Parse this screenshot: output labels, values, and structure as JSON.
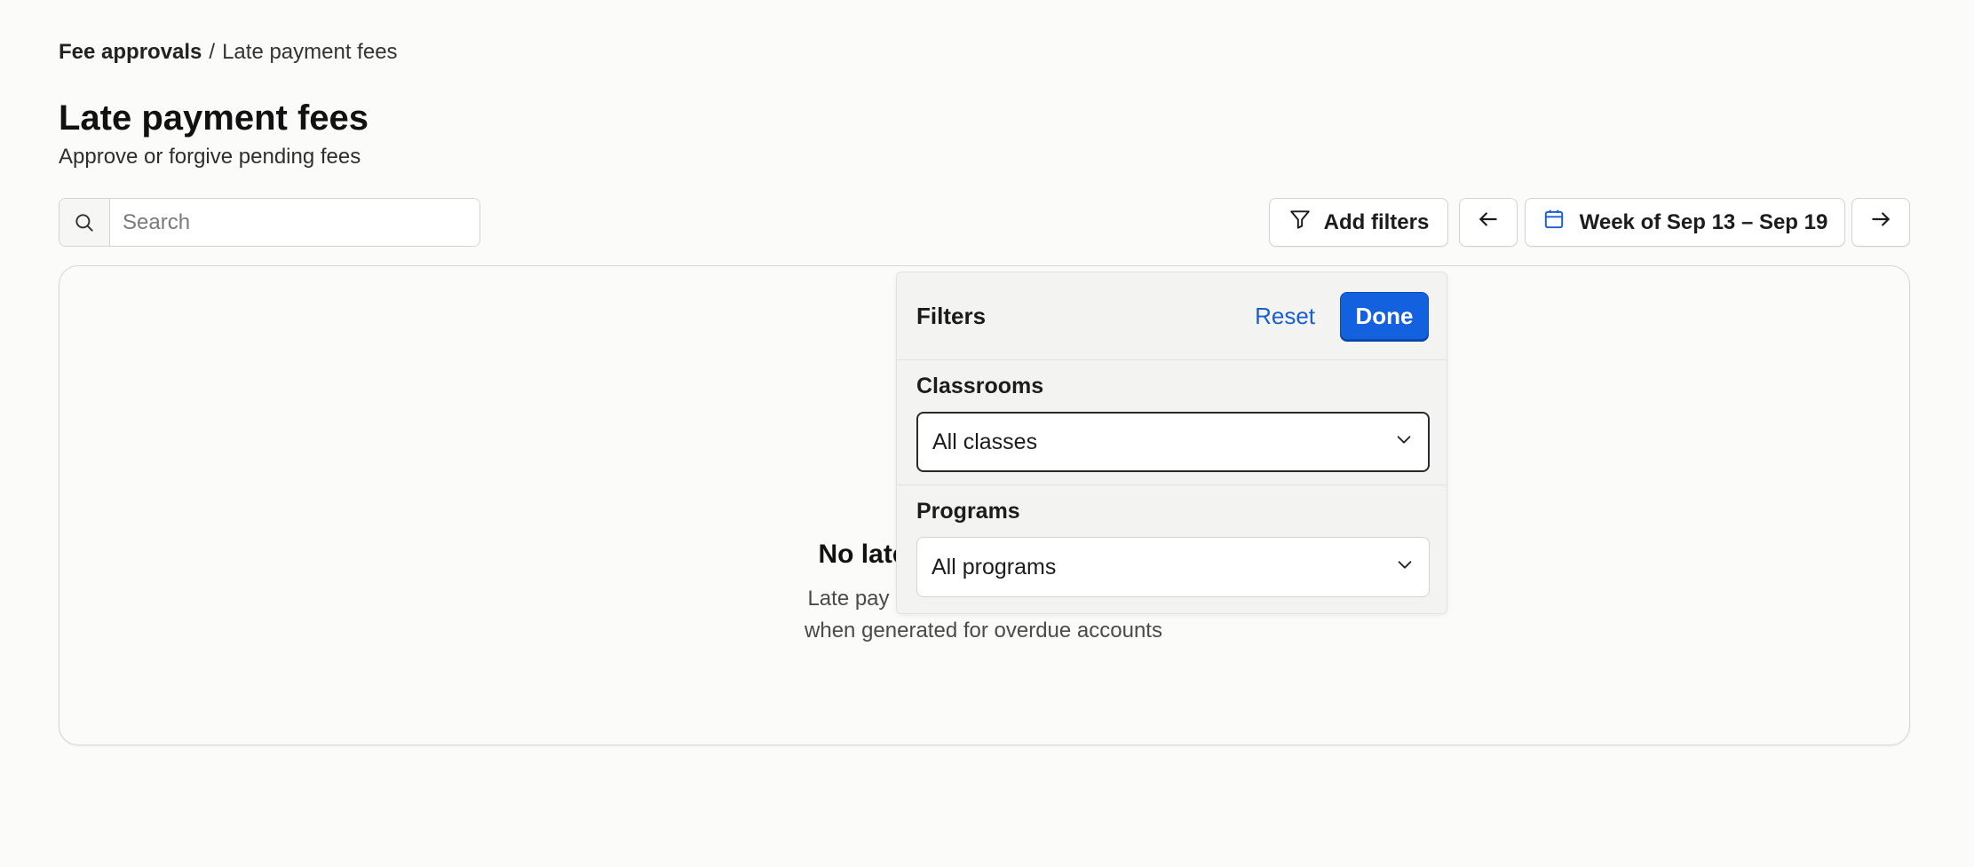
{
  "breadcrumb": {
    "parent": "Fee approvals",
    "separator": "/",
    "current": "Late payment fees"
  },
  "page": {
    "title": "Late payment fees",
    "subtitle": "Approve or forgive pending fees"
  },
  "search": {
    "placeholder": "Search",
    "icon": "search-icon"
  },
  "toolbar": {
    "add_filters_label": "Add filters",
    "add_filters_icon": "filter-icon",
    "prev_icon": "arrow-left-icon",
    "next_icon": "arrow-right-icon",
    "week_label": "Week of Sep 13 – Sep 19",
    "week_icon": "calendar-icon"
  },
  "empty_state": {
    "title": "No late",
    "line1": "Late pay",
    "line2": "when generated for overdue accounts"
  },
  "filters_panel": {
    "title": "Filters",
    "reset_label": "Reset",
    "done_label": "Done",
    "sections": [
      {
        "label": "Classrooms",
        "value": "All classes"
      },
      {
        "label": "Programs",
        "value": "All programs"
      }
    ]
  },
  "colors": {
    "accent": "#1461e0",
    "link": "#1a5fd1",
    "background": "#fbfbfa"
  }
}
